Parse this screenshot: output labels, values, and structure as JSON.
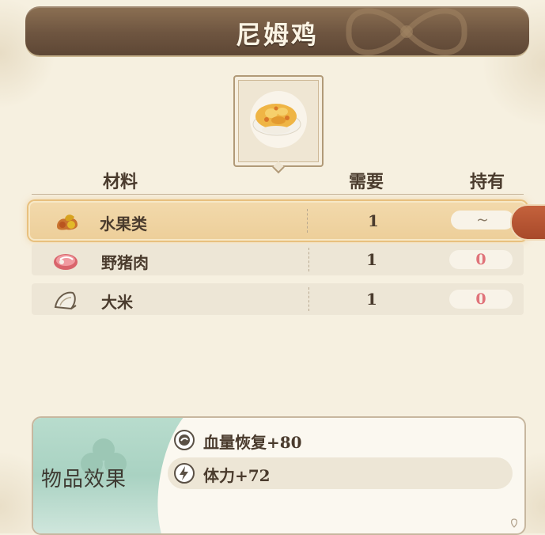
{
  "title": "尼姆鸡",
  "table": {
    "headers": {
      "material": "材料",
      "need": "需要",
      "have": "持有"
    },
    "rows": [
      {
        "icon": "fruit-icon",
        "name": "水果类",
        "need": "1",
        "have": "~"
      },
      {
        "icon": "boar-meat-icon",
        "name": "野猪肉",
        "need": "1",
        "have": "0"
      },
      {
        "icon": "rice-icon",
        "name": "大米",
        "need": "1",
        "have": "0"
      }
    ]
  },
  "effects": {
    "label": "物品效果",
    "items": [
      {
        "icon": "health-icon",
        "text": "血量恢复+80"
      },
      {
        "icon": "stamina-icon",
        "text": "体力+72"
      }
    ]
  },
  "colors": {
    "banner": "#6e5540",
    "highlight": "#edcf9a",
    "zero": "#e0737a",
    "effects_green": "#a9d2c2"
  }
}
